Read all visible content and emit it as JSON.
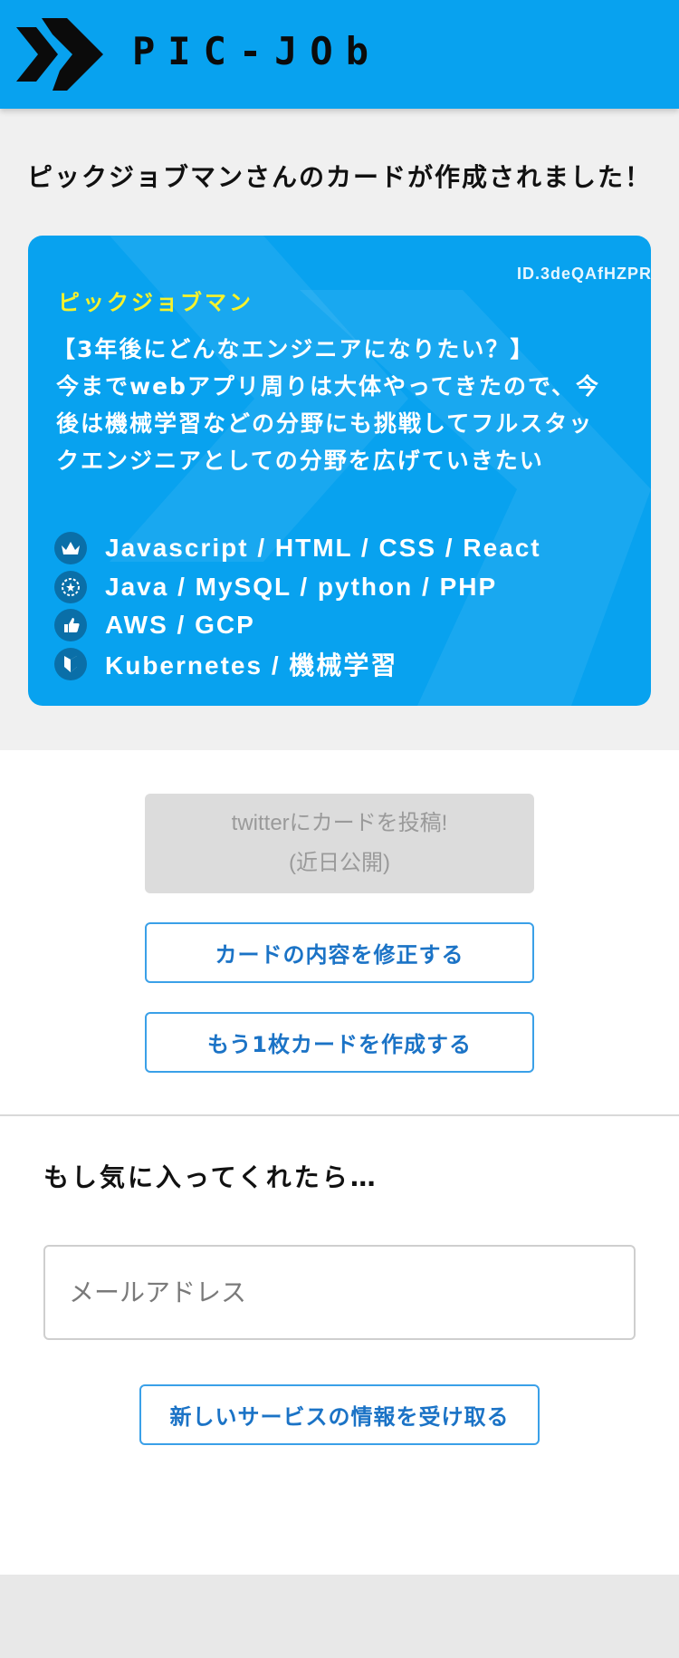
{
  "header": {
    "logo_text": "PIC-JOb"
  },
  "page": {
    "created_message": "ピックジョブマンさんのカードが作成されました！"
  },
  "card": {
    "id": "ID.3deQAfHZPR",
    "name": "ピックジョブマン",
    "question": "【3年後にどんなエンジニアになりたい？】",
    "answer": "今までwebアプリ周りは大体やってきたので、今後は機械学習などの分野にも挑戦してフルスタックエンジニアとしての分野を広げていきたい",
    "skills": [
      {
        "icon": "crown-icon",
        "text": "Javascript / HTML / CSS / React"
      },
      {
        "icon": "laurel-icon",
        "text": "Java / MySQL / python / PHP"
      },
      {
        "icon": "thumbs-up-icon",
        "text": "AWS / GCP"
      },
      {
        "icon": "beginner-icon",
        "text": "Kubernetes / 機械学習"
      }
    ]
  },
  "actions": {
    "twitter_line1": "twitterにカードを投稿!",
    "twitter_line2": "(近日公開)",
    "edit_card": "カードの内容を修正する",
    "create_another": "もう1枚カードを作成する"
  },
  "subscribe": {
    "title": "もし気に入ってくれたら…",
    "email_placeholder": "メールアドレス",
    "submit": "新しいサービスの情報を受け取る"
  },
  "colors": {
    "brand_blue": "#08a2ef",
    "name_yellow": "#f7f22b",
    "button_text": "#1b73c6"
  }
}
